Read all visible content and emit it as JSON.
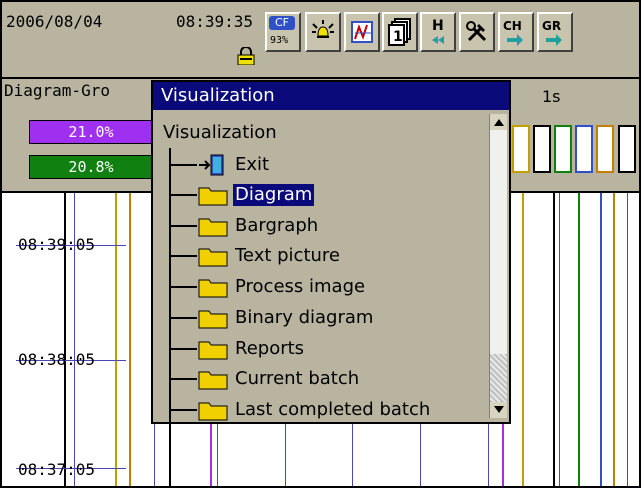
{
  "status": {
    "date": "2006/08/04",
    "time": "08:39:35",
    "cf_label": "CF",
    "cf_percent": "93%"
  },
  "toolbar": {
    "buttons": [
      {
        "name": "cf-card-icon"
      },
      {
        "name": "alarm-bell-icon"
      },
      {
        "name": "diagram-display-icon"
      },
      {
        "name": "page-layers-icon"
      },
      {
        "name": "history-rewind-icon"
      },
      {
        "name": "tools-icon"
      },
      {
        "name": "channel-arrow-icon"
      },
      {
        "name": "group-arrow-icon"
      }
    ],
    "h_label": "H",
    "ch_label": "CH",
    "gr_label": "GR",
    "page_number": "1"
  },
  "header": {
    "group_label": "Diagram-Gro",
    "period": "1s",
    "value1": "21.0%",
    "value2": "20.8%",
    "value1_color": "#a030f0",
    "value2_color": "#108010"
  },
  "chart": {
    "time_labels": [
      "08:39:05",
      "08:38:05",
      "08:37:05"
    ]
  },
  "menu": {
    "title": "Visualization",
    "root": "Visualization",
    "items": [
      {
        "label": "Exit",
        "icon": "exit-door-icon"
      },
      {
        "label": "Diagram",
        "icon": "folder-icon",
        "selected": true
      },
      {
        "label": "Bargraph",
        "icon": "folder-icon"
      },
      {
        "label": "Text picture",
        "icon": "folder-icon"
      },
      {
        "label": "Process image",
        "icon": "folder-icon"
      },
      {
        "label": "Binary diagram",
        "icon": "folder-icon"
      },
      {
        "label": "Reports",
        "icon": "folder-icon"
      },
      {
        "label": "Current batch",
        "icon": "folder-icon"
      },
      {
        "label": "Last completed batch",
        "icon": "folder-icon"
      }
    ]
  }
}
